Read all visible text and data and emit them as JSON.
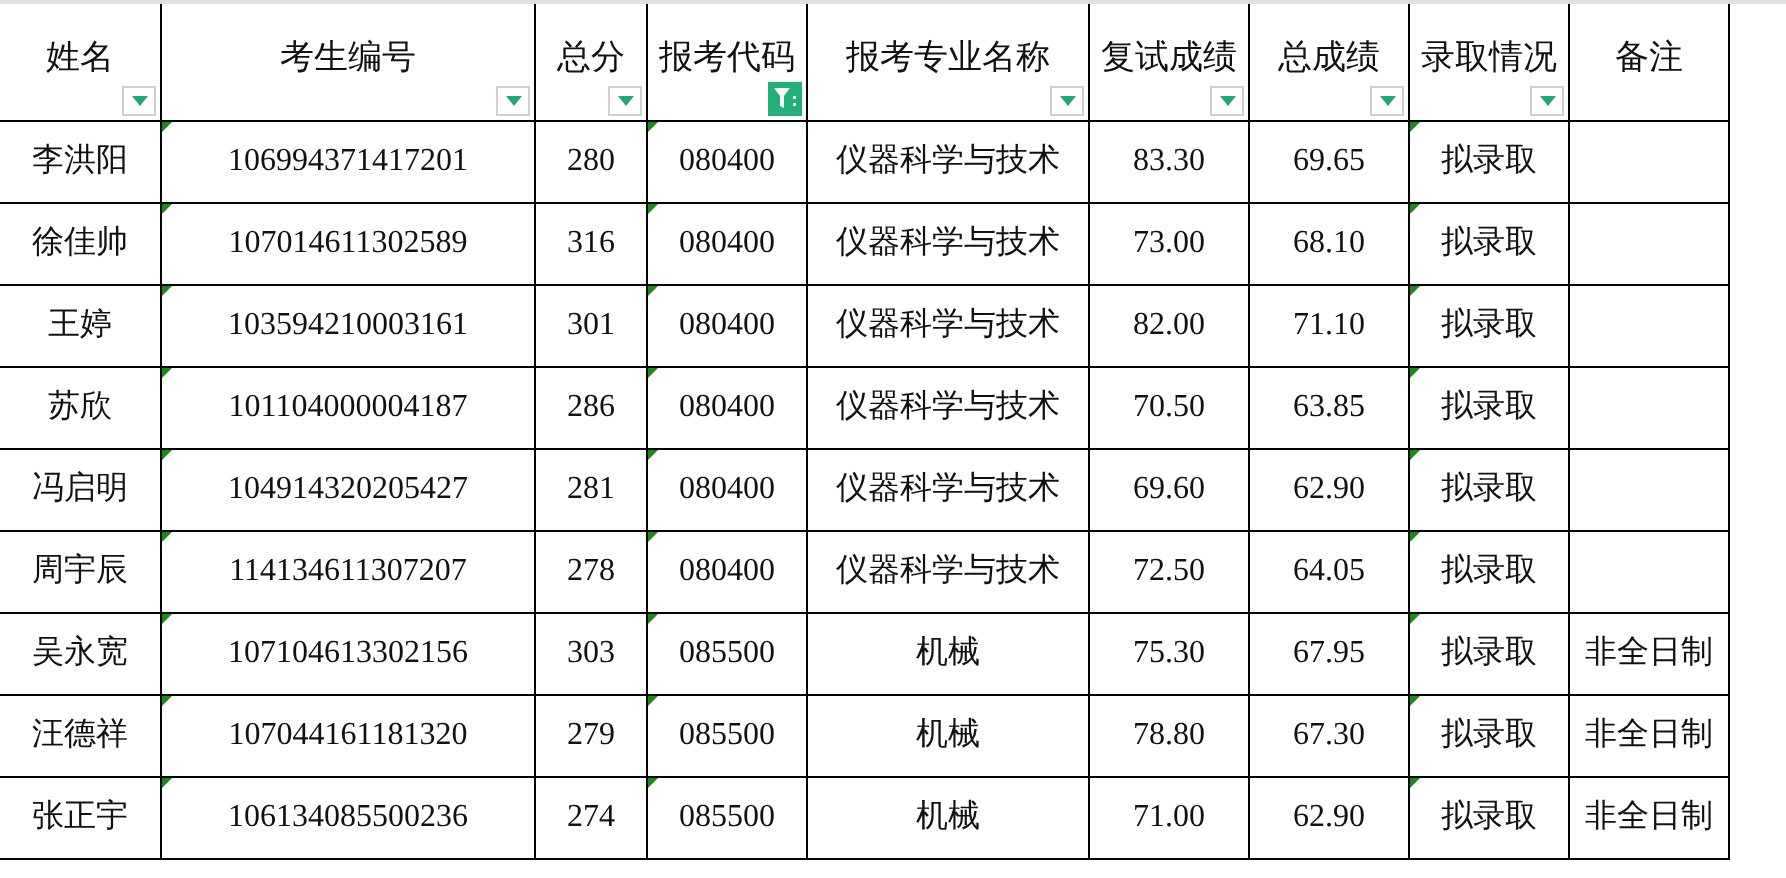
{
  "table": {
    "columns": [
      {
        "label": "姓名",
        "filterable": true,
        "filter_active": false,
        "flagged": false
      },
      {
        "label": "考生编号",
        "filterable": true,
        "filter_active": false,
        "flagged": true
      },
      {
        "label": "总分",
        "filterable": true,
        "filter_active": false,
        "flagged": false
      },
      {
        "label": "报考代码",
        "filterable": true,
        "filter_active": true,
        "flagged": true
      },
      {
        "label": "报考专业名称",
        "filterable": true,
        "filter_active": false,
        "flagged": false
      },
      {
        "label": "复试成绩",
        "filterable": true,
        "filter_active": false,
        "flagged": false
      },
      {
        "label": "总成绩",
        "filterable": true,
        "filter_active": false,
        "flagged": false
      },
      {
        "label": "录取情况",
        "filterable": true,
        "filter_active": false,
        "flagged": true
      },
      {
        "label": "备注",
        "filterable": false,
        "filter_active": false,
        "flagged": false
      }
    ],
    "rows": [
      [
        "李洪阳",
        "106994371417201",
        "280",
        "080400",
        "仪器科学与技术",
        "83.30",
        "69.65",
        "拟录取",
        ""
      ],
      [
        "徐佳帅",
        "107014611302589",
        "316",
        "080400",
        "仪器科学与技术",
        "73.00",
        "68.10",
        "拟录取",
        ""
      ],
      [
        "王婷",
        "103594210003161",
        "301",
        "080400",
        "仪器科学与技术",
        "82.00",
        "71.10",
        "拟录取",
        ""
      ],
      [
        "苏欣",
        "101104000004187",
        "286",
        "080400",
        "仪器科学与技术",
        "70.50",
        "63.85",
        "拟录取",
        ""
      ],
      [
        "冯启明",
        "104914320205427",
        "281",
        "080400",
        "仪器科学与技术",
        "69.60",
        "62.90",
        "拟录取",
        ""
      ],
      [
        "周宇辰",
        "114134611307207",
        "278",
        "080400",
        "仪器科学与技术",
        "72.50",
        "64.05",
        "拟录取",
        ""
      ],
      [
        "吴永宽",
        "107104613302156",
        "303",
        "085500",
        "机械",
        "75.30",
        "67.95",
        "拟录取",
        "非全日制"
      ],
      [
        "汪德祥",
        "107044161181320",
        "279",
        "085500",
        "机械",
        "78.80",
        "67.30",
        "拟录取",
        "非全日制"
      ],
      [
        "张正宇",
        "106134085500236",
        "274",
        "085500",
        "机械",
        "71.00",
        "62.90",
        "拟录取",
        "非全日制"
      ]
    ]
  }
}
